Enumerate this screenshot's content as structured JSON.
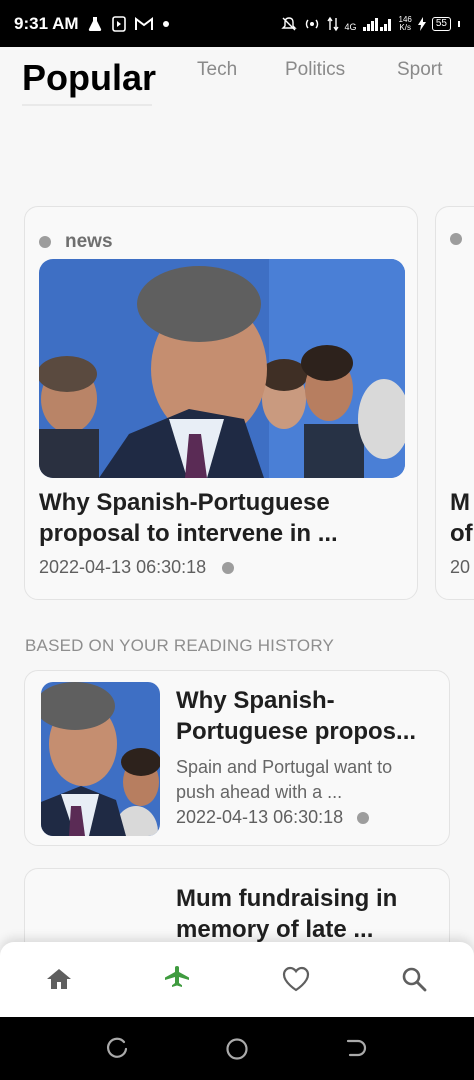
{
  "status_bar": {
    "time": "9:31 AM",
    "network": "4G",
    "speed_value": "146",
    "speed_unit": "K/s",
    "battery": "55",
    "icons": [
      "flask-icon",
      "media-icon",
      "gmail-icon",
      "dot-icon",
      "mute-icon",
      "hotspot-icon",
      "data-arrows-icon",
      "signal-icon",
      "battery-icon"
    ]
  },
  "tabs": [
    {
      "label": "Popular",
      "active": true
    },
    {
      "label": "Tech",
      "active": false
    },
    {
      "label": "Politics",
      "active": false
    },
    {
      "label": "Sport",
      "active": false
    }
  ],
  "carousel": [
    {
      "category": "news",
      "title_line1": "Why Spanish-Portuguese",
      "title_line2": "proposal to intervene in ...",
      "date": "2022-04-13 06:30:18"
    },
    {
      "title_line1": "M",
      "title_line2": "of",
      "date": "20"
    }
  ],
  "section_header": "BASED ON YOUR READING HISTORY",
  "list": [
    {
      "title_line1": "Why Spanish-",
      "title_line2": "Portuguese propos...",
      "summary_line1": "Spain and Portugal want to",
      "summary_line2": "push ahead with a ...",
      "date": "2022-04-13 06:30:18"
    },
    {
      "title_line1": "Mum fundraising in",
      "title_line2": "memory of late ..."
    }
  ],
  "bottom_nav": {
    "items": [
      "home-icon",
      "plane-icon",
      "heart-icon",
      "search-icon"
    ],
    "active_index": 1,
    "active_color": "#3f9b3f",
    "inactive_color": "#5f5f5f"
  },
  "colors": {
    "background": "#f7f7f7",
    "card": "#f9f9f9",
    "accent": "#3f9b3f"
  }
}
